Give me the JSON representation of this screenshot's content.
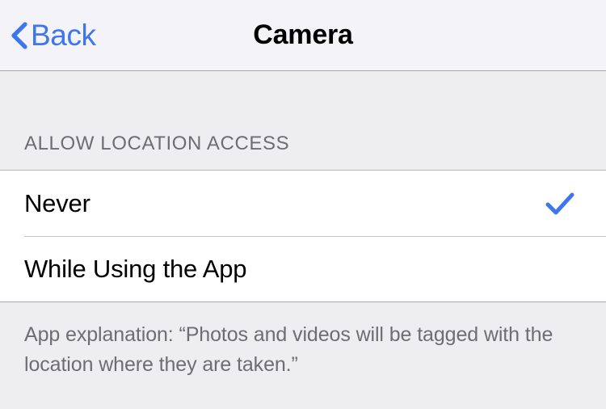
{
  "navbar": {
    "back_label": "Back",
    "back_icon": "chevron-left-icon",
    "title": "Camera",
    "tint_color": "#3e76ee",
    "background_color": "#f4f3f7"
  },
  "section": {
    "header": "ALLOW LOCATION ACCESS",
    "options": [
      {
        "label": "Never",
        "selected": true,
        "accessory_icon": "checkmark-icon"
      },
      {
        "label": "While Using the App",
        "selected": false,
        "accessory_icon": ""
      }
    ],
    "footer": "App explanation: “Photos and videos will be tagged with the location where they are taken.”",
    "selected_color": "#3e76ee",
    "header_color": "#6d6d72",
    "background_color": "#eeeef0"
  }
}
